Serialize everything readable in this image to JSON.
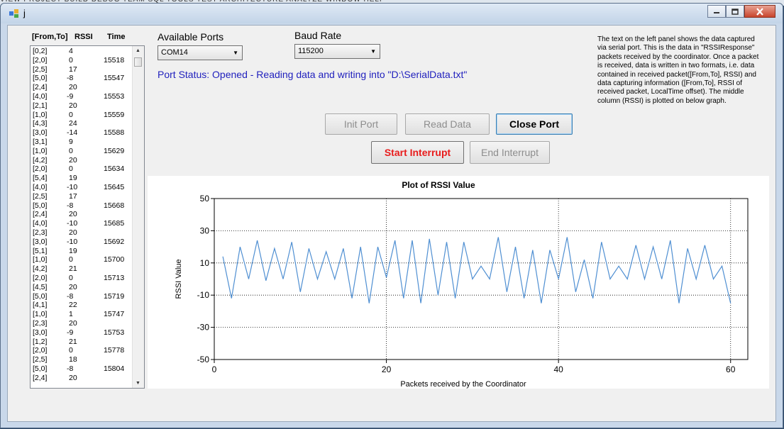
{
  "background": {
    "menu_items": [
      "VIEW",
      "PROJECT",
      "BUILD",
      "DEBUG",
      "TEAM",
      "SQL",
      "TOOLS",
      "TEST",
      "ARCHITECTURE",
      "ANALYZE",
      "WINDOW",
      "HELP"
    ]
  },
  "window": {
    "title": "j",
    "icon": "app-windows-form-icon",
    "controls": {
      "minimize": "minimize-icon",
      "maximize": "maximize-icon",
      "close": "close-icon"
    }
  },
  "left_panel": {
    "headers": {
      "from_to": "[From,To]",
      "rssi": "RSSI",
      "time": "Time"
    },
    "rows": [
      {
        "ft": "[0,2]",
        "rssi": "4",
        "time": ""
      },
      {
        "ft": "[2,0]",
        "rssi": "0",
        "time": "15518"
      },
      {
        "ft": "[2,5]",
        "rssi": "17",
        "time": ""
      },
      {
        "ft": "[5,0]",
        "rssi": "-8",
        "time": "15547"
      },
      {
        "ft": "[2,4]",
        "rssi": "20",
        "time": ""
      },
      {
        "ft": "[4,0]",
        "rssi": "-9",
        "time": "15553"
      },
      {
        "ft": "[2,1]",
        "rssi": "20",
        "time": ""
      },
      {
        "ft": "[1,0]",
        "rssi": "0",
        "time": "15559"
      },
      {
        "ft": "[4,3]",
        "rssi": "24",
        "time": ""
      },
      {
        "ft": "[3,0]",
        "rssi": "-14",
        "time": "15588"
      },
      {
        "ft": "[3,1]",
        "rssi": "9",
        "time": ""
      },
      {
        "ft": "[1,0]",
        "rssi": "0",
        "time": "15629"
      },
      {
        "ft": "[4,2]",
        "rssi": "20",
        "time": ""
      },
      {
        "ft": "[2,0]",
        "rssi": "0",
        "time": "15634"
      },
      {
        "ft": "[5,4]",
        "rssi": "19",
        "time": ""
      },
      {
        "ft": "[4,0]",
        "rssi": "-10",
        "time": "15645"
      },
      {
        "ft": "[2,5]",
        "rssi": "17",
        "time": ""
      },
      {
        "ft": "[5,0]",
        "rssi": "-8",
        "time": "15668"
      },
      {
        "ft": "[2,4]",
        "rssi": "20",
        "time": ""
      },
      {
        "ft": "[4,0]",
        "rssi": "-10",
        "time": "15685"
      },
      {
        "ft": "[2,3]",
        "rssi": "20",
        "time": ""
      },
      {
        "ft": "[3,0]",
        "rssi": "-10",
        "time": "15692"
      },
      {
        "ft": "[5,1]",
        "rssi": "19",
        "time": ""
      },
      {
        "ft": "[1,0]",
        "rssi": "0",
        "time": "15700"
      },
      {
        "ft": "[4,2]",
        "rssi": "21",
        "time": ""
      },
      {
        "ft": "[2,0]",
        "rssi": "0",
        "time": "15713"
      },
      {
        "ft": "[4,5]",
        "rssi": "20",
        "time": ""
      },
      {
        "ft": "[5,0]",
        "rssi": "-8",
        "time": "15719"
      },
      {
        "ft": "[4,1]",
        "rssi": "22",
        "time": ""
      },
      {
        "ft": "[1,0]",
        "rssi": "1",
        "time": "15747"
      },
      {
        "ft": "[2,3]",
        "rssi": "20",
        "time": ""
      },
      {
        "ft": "[3,0]",
        "rssi": "-9",
        "time": "15753"
      },
      {
        "ft": "[1,2]",
        "rssi": "21",
        "time": ""
      },
      {
        "ft": "[2,0]",
        "rssi": "0",
        "time": "15778"
      },
      {
        "ft": "[2,5]",
        "rssi": "18",
        "time": ""
      },
      {
        "ft": "[5,0]",
        "rssi": "-8",
        "time": "15804"
      },
      {
        "ft": "[2,4]",
        "rssi": "20",
        "time": ""
      }
    ]
  },
  "ports": {
    "label": "Available Ports",
    "selected": "COM14"
  },
  "baud": {
    "label": "Baud Rate",
    "selected": "115200"
  },
  "port_status": "Port Status: Opened - Reading data and writing into \"D:\\SerialData.txt\"",
  "description": "The text on the left panel shows the data captured via serial port.  This is the data in \"RSSIResponse\" packets received by the coordinator. Once a packet is received, data is written in two formats, i.e. data contained in received packet([From,To], RSSI) and data capturing information ([From,To], RSSI  of received packet, LocalTime offset). The middle column (RSSI) is plotted on below graph.",
  "buttons": {
    "init_port": "Init Port",
    "read_data": "Read Data",
    "close_port": "Close Port",
    "start_interrupt": "Start Interrupt",
    "end_interrupt": "End Interrupt"
  },
  "colors": {
    "series": "#4f8fd2",
    "status": "#1f1fbd",
    "start_interrupt": "#e81c1c"
  },
  "chart_data": {
    "type": "line",
    "title": "Plot of RSSI Value",
    "xlabel": "Packets received by the Coordinator",
    "ylabel": "RSSI Value",
    "xlim": [
      0,
      62
    ],
    "ylim": [
      -50,
      50
    ],
    "xticks": [
      0,
      20,
      40,
      60
    ],
    "yticks": [
      50,
      30,
      10,
      -10,
      -30,
      -50
    ],
    "grid": true,
    "legend": "none",
    "series": [
      {
        "x": [
          1,
          2,
          3,
          4,
          5,
          6,
          7,
          8,
          9,
          10,
          11,
          12,
          13,
          14,
          15,
          16,
          17,
          18,
          19,
          20,
          21,
          22,
          23,
          24,
          25,
          26,
          27,
          28,
          29,
          30,
          31,
          32,
          33,
          34,
          35,
          36,
          37,
          38,
          39,
          40,
          41,
          42,
          43,
          44,
          45,
          46,
          47,
          48,
          49,
          50,
          51,
          52,
          53,
          54,
          55,
          56,
          57,
          58,
          59,
          60
        ],
        "values": [
          14,
          -12,
          20,
          0,
          24,
          -1,
          19,
          0,
          23,
          -8,
          19,
          0,
          17,
          0,
          19,
          -12,
          20,
          -15,
          20,
          1,
          24,
          -12,
          24,
          -15,
          25,
          -10,
          23,
          -12,
          23,
          0,
          8,
          0,
          26,
          -8,
          20,
          -12,
          18,
          -15,
          18,
          0,
          26,
          -8,
          12,
          -12,
          23,
          0,
          8,
          0,
          21,
          0,
          20,
          0,
          24,
          -15,
          19,
          0,
          21,
          0,
          8,
          -15
        ]
      }
    ]
  }
}
